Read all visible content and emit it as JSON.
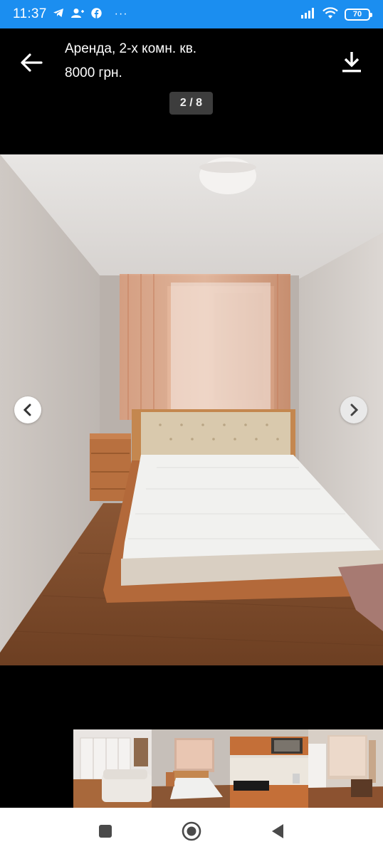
{
  "status_bar": {
    "time": "11:37",
    "left_icons": [
      "telegram-icon",
      "contact-add-icon",
      "facebook-icon",
      "more-dots-icon"
    ],
    "more_dots": "···",
    "battery": "70"
  },
  "header": {
    "title": "Аренда, 2-х комн. кв.",
    "price": "8000 грн.",
    "counter": "2 / 8"
  },
  "gallery": {
    "current_photo": "bedroom-photo",
    "thumbnails": [
      "living-room-thumbnail",
      "bedroom-thumbnail",
      "kitchen-thumbnail",
      "balcony-room-thumbnail"
    ]
  },
  "colors": {
    "status_bar": "#1b8ef0",
    "background": "#000000",
    "badge": "#3d3d3d"
  }
}
